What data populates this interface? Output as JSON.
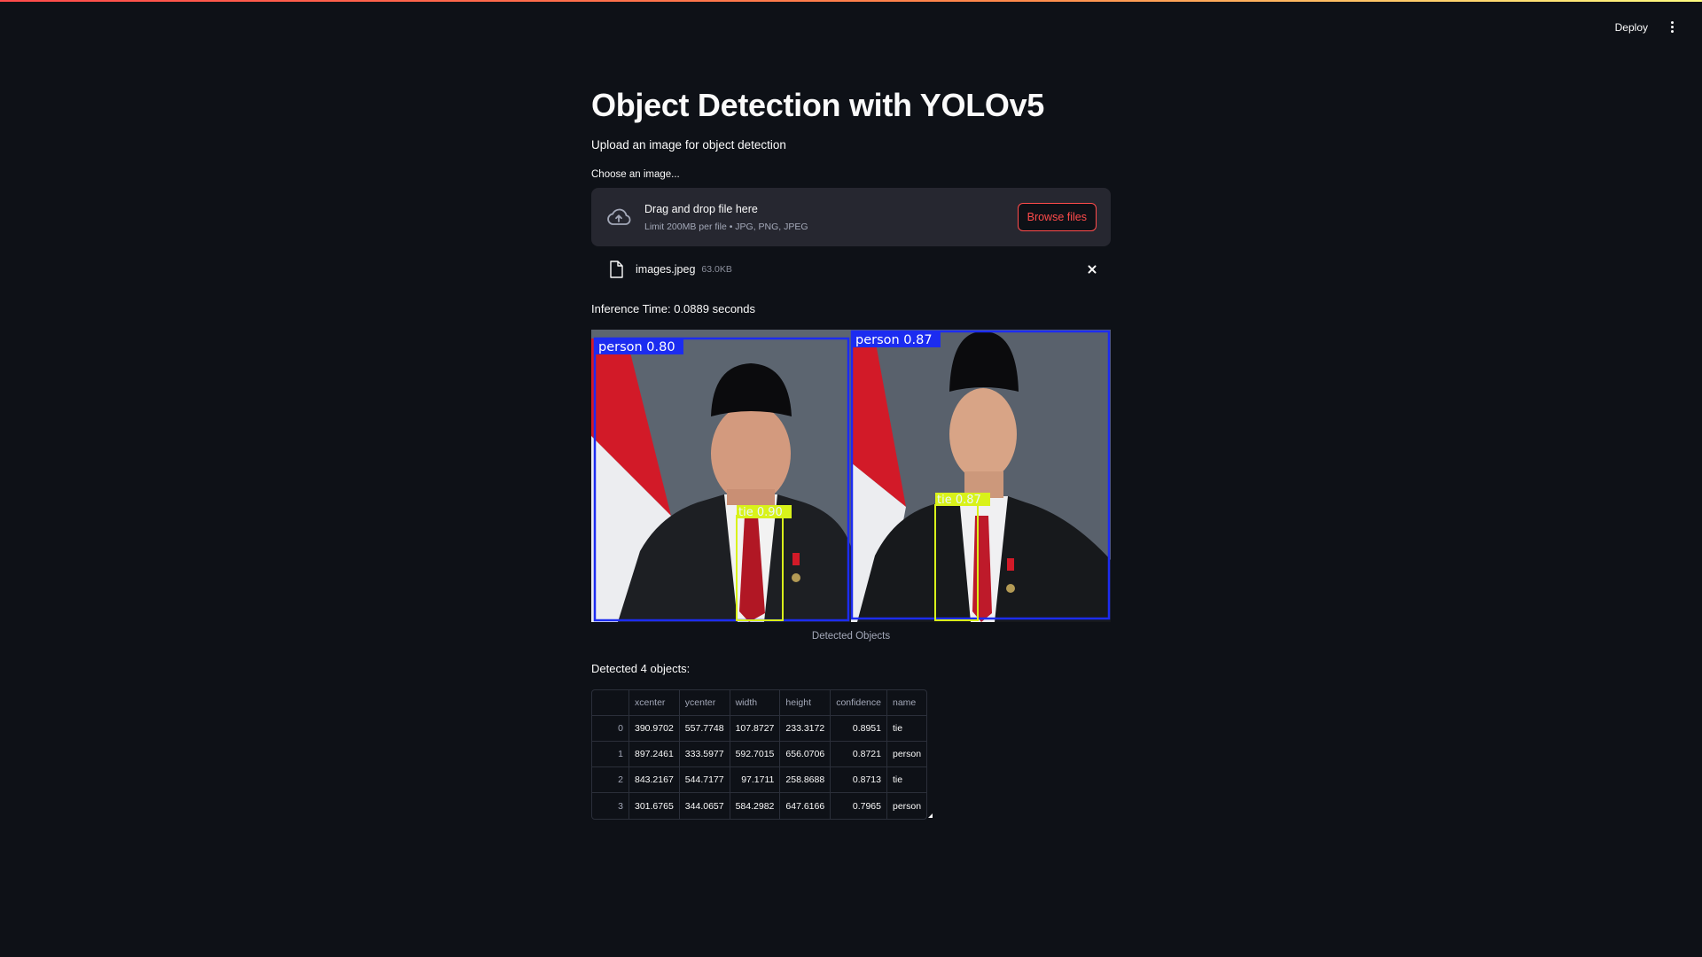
{
  "header": {
    "deploy_label": "Deploy"
  },
  "main": {
    "title": "Object Detection with YOLOv5",
    "subtitle": "Upload an image for object detection",
    "uploader_label": "Choose an image..."
  },
  "uploader": {
    "drop_text": "Drag and drop file here",
    "limit_text": "Limit 200MB per file • JPG, PNG, JPEG",
    "browse_label": "Browse files",
    "file_name": "images.jpeg",
    "file_size": "63.0KB"
  },
  "inference_text": "Inference Time: 0.0889 seconds",
  "image": {
    "caption": "Detected Objects",
    "labels": {
      "left_person": "person  0.80",
      "right_person": "person  0.87",
      "left_tie": "tie  0.90",
      "right_tie": "tie  0.87"
    },
    "colors": {
      "person_box": "#1c2cf0",
      "tie_box": "#d9f21a"
    }
  },
  "detected_label": "Detected 4 objects:",
  "table": {
    "columns": [
      "",
      "xcenter",
      "ycenter",
      "width",
      "height",
      "confidence",
      "name"
    ],
    "rows": [
      [
        "0",
        "390.9702",
        "557.7748",
        "107.8727",
        "233.3172",
        "0.8951",
        "tie"
      ],
      [
        "1",
        "897.2461",
        "333.5977",
        "592.7015",
        "656.0706",
        "0.8721",
        "person"
      ],
      [
        "2",
        "843.2167",
        "544.7177",
        "97.1711",
        "258.8688",
        "0.8713",
        "tie"
      ],
      [
        "3",
        "301.6765",
        "344.0657",
        "584.2982",
        "647.6166",
        "0.7965",
        "person"
      ]
    ]
  },
  "colors": {
    "background": "#0e1117",
    "surface": "#262730",
    "accent": "#ff4b4b"
  }
}
